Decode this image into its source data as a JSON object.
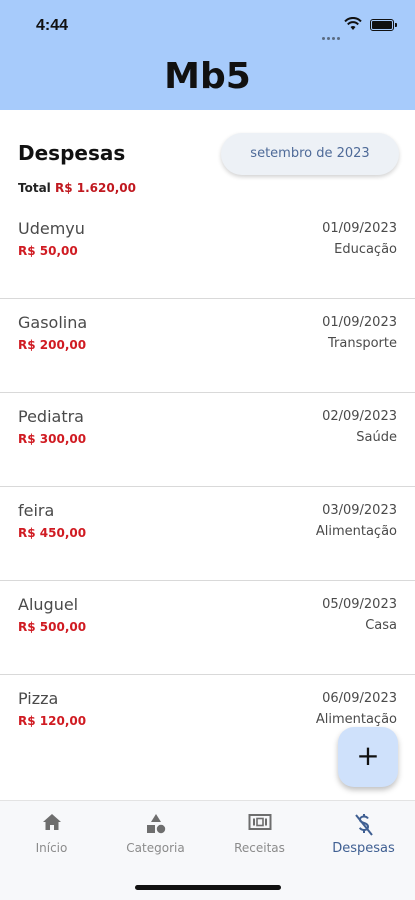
{
  "status_bar": {
    "time": "4:44"
  },
  "header": {
    "title": "Mb5"
  },
  "expenses": {
    "title": "Despesas",
    "month_filter": "setembro de 2023",
    "total_label": "Total",
    "total_value": "R$ 1.620,00",
    "items": [
      {
        "name": "Udemyu",
        "value": "R$ 50,00",
        "date": "01/09/2023",
        "category": "Educação"
      },
      {
        "name": "Gasolina",
        "value": "R$ 200,00",
        "date": "01/09/2023",
        "category": "Transporte"
      },
      {
        "name": "Pediatra",
        "value": "R$ 300,00",
        "date": "02/09/2023",
        "category": "Saúde"
      },
      {
        "name": "feira",
        "value": "R$ 450,00",
        "date": "03/09/2023",
        "category": "Alimentação"
      },
      {
        "name": "Aluguel",
        "value": "R$ 500,00",
        "date": "05/09/2023",
        "category": "Casa"
      },
      {
        "name": "Pizza",
        "value": "R$ 120,00",
        "date": "06/09/2023",
        "category": "Alimentação"
      }
    ]
  },
  "fab": {
    "label": "+"
  },
  "tabs": [
    {
      "label": "Início",
      "icon": "home-icon"
    },
    {
      "label": "Categoria",
      "icon": "shapes-icon"
    },
    {
      "label": "Receitas",
      "icon": "cash-icon"
    },
    {
      "label": "Despesas",
      "icon": "dollar-slash-icon",
      "active": true
    }
  ],
  "colors": {
    "header_bg": "#a7cbfb",
    "expense_red": "#d01b22",
    "active_tab": "#3f5f92",
    "fab_bg": "#cfe1fb"
  }
}
